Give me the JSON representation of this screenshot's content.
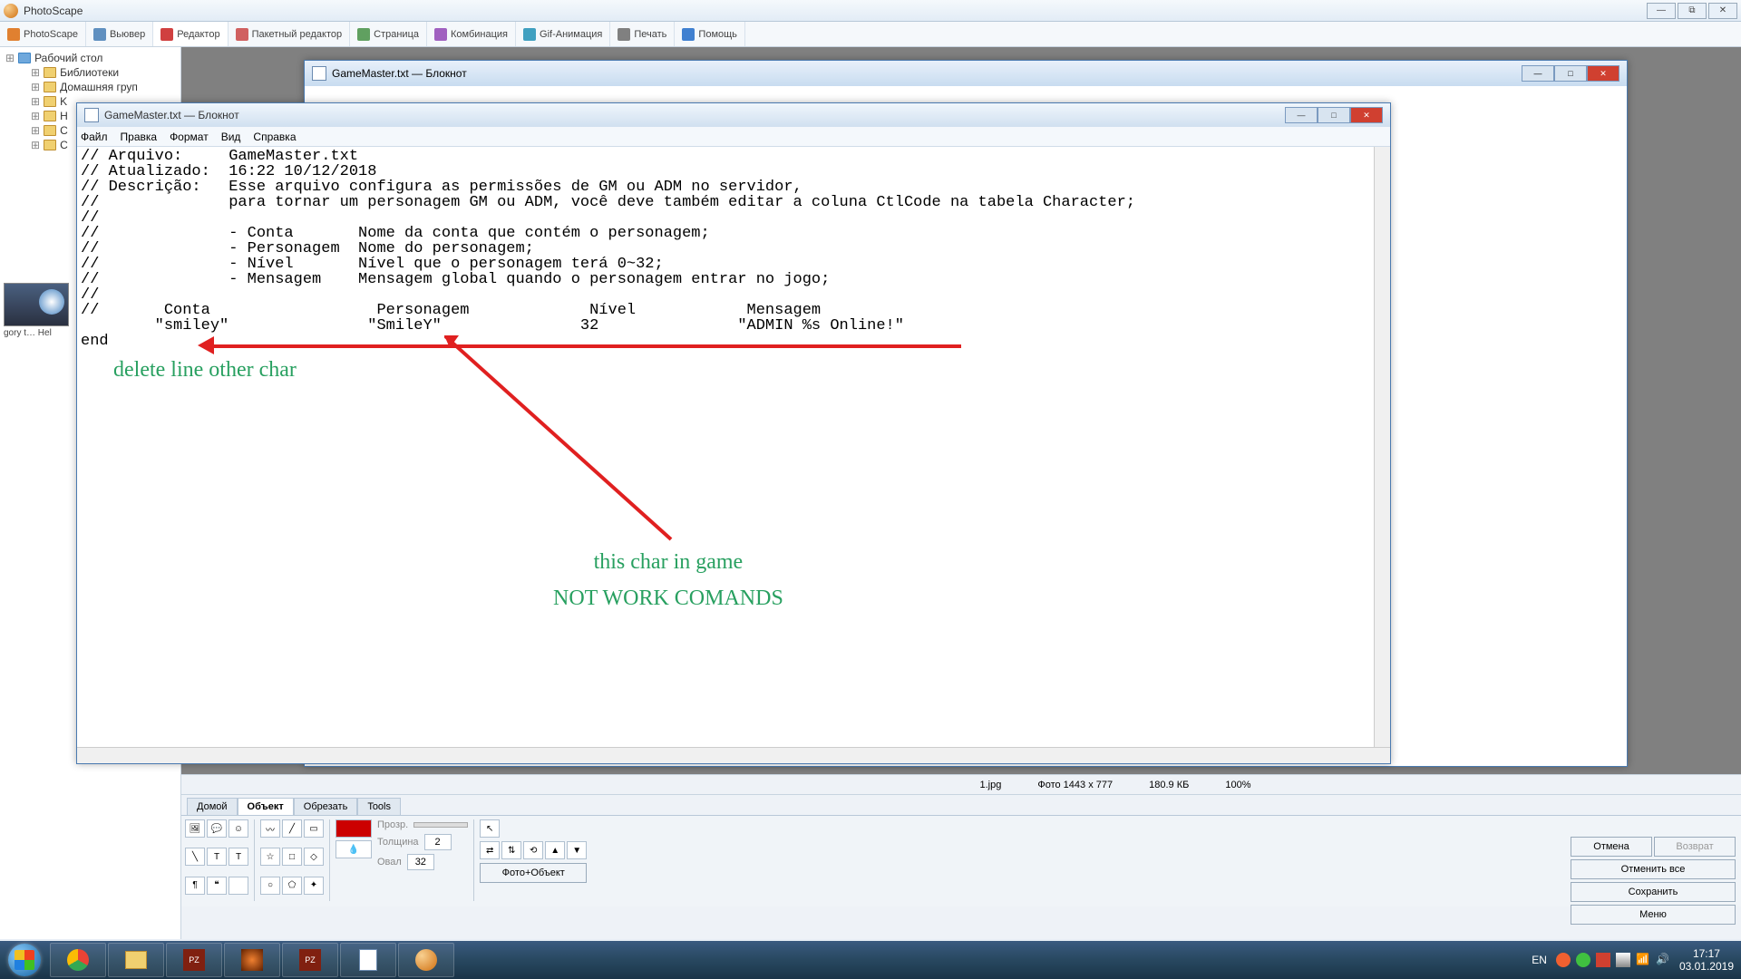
{
  "photoscape": {
    "title": "PhotoScape",
    "toolbar": [
      {
        "label": "PhotoScape",
        "icon_color": "#e08030"
      },
      {
        "label": "Вьювер",
        "icon_color": "#6090c0"
      },
      {
        "label": "Редактор",
        "icon_color": "#d04040",
        "active": true
      },
      {
        "label": "Пакетный редактор",
        "icon_color": "#d06060"
      },
      {
        "label": "Страница",
        "icon_color": "#60a060"
      },
      {
        "label": "Комбинация",
        "icon_color": "#a060c0"
      },
      {
        "label": "Gif-Анимация",
        "icon_color": "#40a0c0"
      },
      {
        "label": "Печать",
        "icon_color": "#808080"
      },
      {
        "label": "Помощь",
        "icon_color": "#4080d0"
      }
    ],
    "tree": [
      {
        "label": "Рабочий стол",
        "class": "root",
        "icon": "desk"
      },
      {
        "label": "Библиотеки",
        "class": "lv2"
      },
      {
        "label": "Домашняя груп",
        "class": "lv2"
      },
      {
        "label": "K",
        "class": "lv2"
      },
      {
        "label": "H",
        "class": "lv2"
      },
      {
        "label": "C",
        "class": "lv2"
      },
      {
        "label": "C",
        "class": "lv2"
      }
    ],
    "thumb_label": "gory t…   Hel",
    "status": {
      "filename": "1.jpg",
      "dims": "Фото 1443 x 777",
      "size": "180.9 КБ",
      "zoom": "100%"
    },
    "tabs": [
      "Домой",
      "Объект",
      "Обрезать",
      "Tools"
    ],
    "active_tab": "Объект",
    "props": {
      "transp": "Прозр.",
      "thick": "Толщина",
      "thick_val": "2",
      "oval": "Овал",
      "oval_val": "32"
    },
    "photoobj_btn": "Фото+Объект",
    "right_btns": [
      "Отмена",
      "Возврат",
      "Отменить все",
      "Сохранить",
      "Меню"
    ]
  },
  "notepad_bg": {
    "title": "GameMaster.txt — Блокнот"
  },
  "notepad_fg": {
    "title": "GameMaster.txt — Блокнот",
    "menu": [
      "Файл",
      "Правка",
      "Формат",
      "Вид",
      "Справка"
    ],
    "content": "// Arquivo:     GameMaster.txt\n// Atualizado:  16:22 10/12/2018\n// Descrição:   Esse arquivo configura as permissões de GM ou ADM no servidor,\n//              para tornar um personagem GM ou ADM, você deve também editar a coluna CtlCode na tabela Character;\n//\n//              - Conta       Nome da conta que contém o personagem;\n//              - Personagem  Nome do personagem;\n//              - Nível       Nível que o personagem terá 0~32;\n//              - Mensagem    Mensagem global quando o personagem entrar no jogo;\n//\n//       Conta                  Personagem             Nível            Mensagem\n        \"smiley\"               \"SmileY\"               32               \"ADMIN %s Online!\"\nend"
  },
  "annotations": {
    "delete_line": "delete line other char",
    "char_msg": "this char in game\nNOT WORK COMANDS"
  },
  "taskbar": {
    "lang": "EN",
    "time": "17:17",
    "date": "03.01.2019"
  }
}
